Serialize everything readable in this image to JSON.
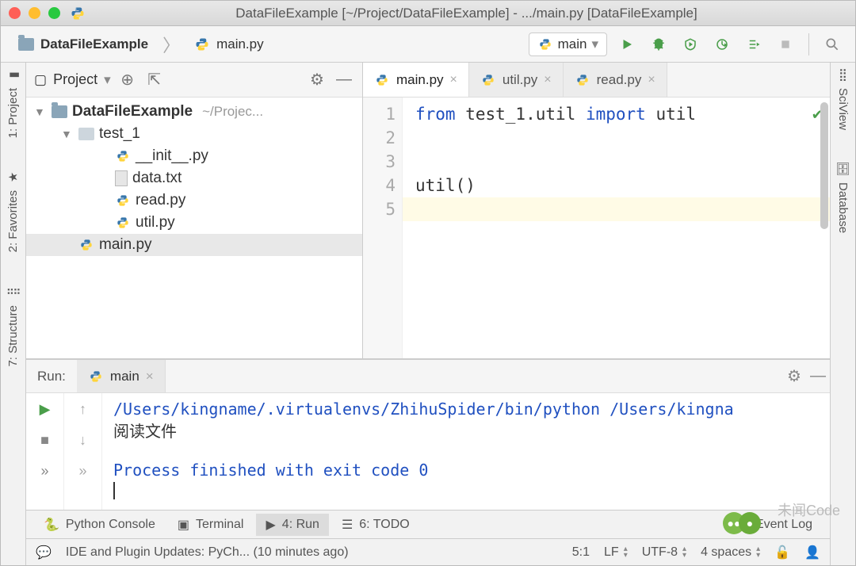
{
  "title": "DataFileExample [~/Project/DataFileExample] - .../main.py [DataFileExample]",
  "breadcrumb": {
    "project": "DataFileExample",
    "file": "main.py"
  },
  "run_config": {
    "name": "main"
  },
  "left_rail": [
    {
      "label": "1: Project",
      "icon": "📁"
    },
    {
      "label": "2: Favorites",
      "icon": "★"
    },
    {
      "label": "7: Structure",
      "icon": "⣿"
    }
  ],
  "right_rail": [
    {
      "label": "SciView",
      "icon": "⣿"
    },
    {
      "label": "Database",
      "icon": "🗄"
    }
  ],
  "project_panel": {
    "title": "Project",
    "root": {
      "name": "DataFileExample",
      "path": "~/Projec..."
    },
    "tree": [
      {
        "name": "test_1",
        "type": "dir",
        "children": [
          {
            "name": "__init__.py",
            "type": "py"
          },
          {
            "name": "data.txt",
            "type": "txt"
          },
          {
            "name": "read.py",
            "type": "py"
          },
          {
            "name": "util.py",
            "type": "py"
          }
        ]
      },
      {
        "name": "main.py",
        "type": "py",
        "selected": true
      }
    ]
  },
  "editor": {
    "tabs": [
      {
        "label": "main.py",
        "active": true
      },
      {
        "label": "util.py",
        "active": false
      },
      {
        "label": "read.py",
        "active": false
      }
    ],
    "lines": [
      "1",
      "2",
      "3",
      "4",
      "5"
    ],
    "code": {
      "l1_kw1": "from",
      "l1_mid": " test_1.util ",
      "l1_kw2": "import",
      "l1_end": " util",
      "l4": "util()"
    }
  },
  "run_panel": {
    "label": "Run:",
    "tab": "main",
    "output": {
      "path": "/Users/kingname/.virtualenvs/ZhihuSpider/bin/python /Users/kingna",
      "line2": "阅读文件",
      "exit": "Process finished with exit code 0"
    }
  },
  "tool_tabs": {
    "python_console": "Python Console",
    "terminal": "Terminal",
    "run": "4: Run",
    "todo": "6: TODO",
    "event_log": "Event Log"
  },
  "status": {
    "message": "IDE and Plugin Updates: PyCh... (10 minutes ago)",
    "position": "5:1",
    "line_sep": "LF",
    "encoding": "UTF-8",
    "indent": "4 spaces"
  },
  "watermark": "未闻Code"
}
